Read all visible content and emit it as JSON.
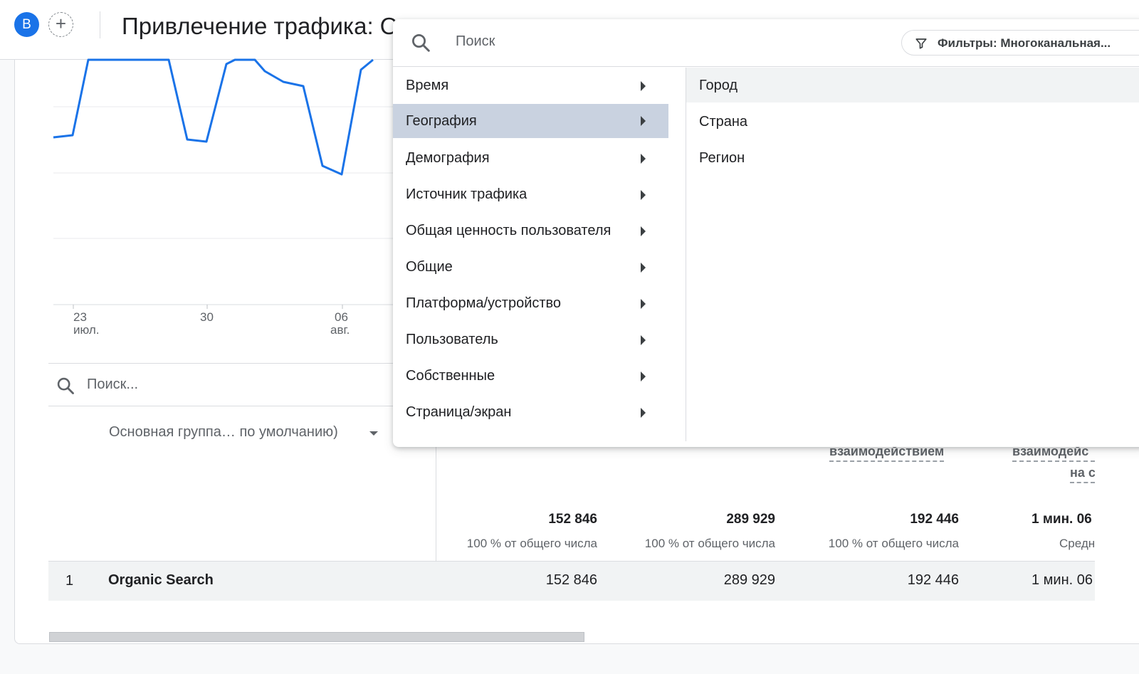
{
  "header": {
    "avatar_letter": "B",
    "add_symbol": "+",
    "title": "Привлечение трафика: О"
  },
  "chart": {
    "x_ticks": [
      {
        "day": "23",
        "month": "июл."
      },
      {
        "day": "30",
        "month": ""
      },
      {
        "day": "06",
        "month": "авг."
      }
    ],
    "line_color": "#1a73e8"
  },
  "table": {
    "search_placeholder": "Поиск...",
    "group_select": "Основная группа… по умолчанию)",
    "columns": [
      {
        "label": "",
        "total": "152 846",
        "total_sub": "100 % от общего числа"
      },
      {
        "label": "",
        "total": "289 929",
        "total_sub": "100 % от общего числа"
      },
      {
        "label": "взаимодействием",
        "total": "192 446",
        "total_sub": "100 % от общего числа"
      },
      {
        "label": "взаимодейс",
        "label2": "на с",
        "total": "1 мин. 06",
        "total_sub": "Средн"
      }
    ],
    "rows": [
      {
        "index": "1",
        "name": "Organic Search",
        "values": [
          "152 846",
          "289 929",
          "192 446",
          "1 мин. 06"
        ]
      }
    ]
  },
  "dropdown": {
    "search_placeholder": "Поиск",
    "filter_chip": "Фильтры: Многоканальная...",
    "categories": [
      {
        "label": "Время"
      },
      {
        "label": "География",
        "active": true
      },
      {
        "label": "Демография"
      },
      {
        "label": "Источник трафика"
      },
      {
        "label": "Общая ценность пользователя"
      },
      {
        "label": "Общие"
      },
      {
        "label": "Платформа/устройство"
      },
      {
        "label": "Пользователь"
      },
      {
        "label": "Собственные"
      },
      {
        "label": "Страница/экран"
      }
    ],
    "subitems": [
      {
        "label": "Город"
      },
      {
        "label": "Страна"
      },
      {
        "label": "Регион"
      }
    ]
  }
}
